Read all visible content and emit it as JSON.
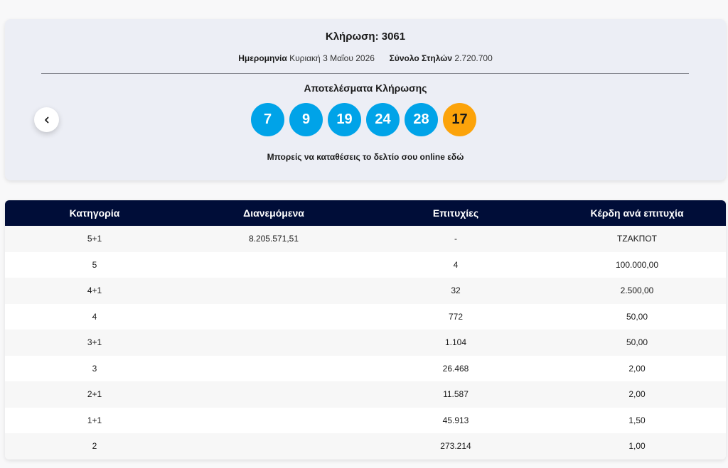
{
  "draw": {
    "title": "Κλήρωση: 3061",
    "date_label": "Ημερομηνία",
    "date_value": "Κυριακή 3 Μαΐου 2026",
    "columns_label": "Σύνολο Στηλών",
    "columns_value": "2.720.700",
    "results_title": "Αποτελέσματα Κλήρωσης",
    "numbers": [
      "7",
      "9",
      "19",
      "24",
      "28"
    ],
    "bonus": "17",
    "online_text": "Μπορείς να καταθέσεις το δελτίο σου online εδώ",
    "prev_icon": "chevron-left-icon"
  },
  "colors": {
    "ball": "#00a3e8",
    "bonus_ball": "#fca30a",
    "table_header": "#000d38"
  },
  "table": {
    "headers": [
      "Κατηγορία",
      "Διανεμόμενα",
      "Επιτυχίες",
      "Κέρδη ανά επιτυχία"
    ],
    "rows": [
      [
        "5+1",
        "8.205.571,51",
        "-",
        "ΤΖΑΚΠΟΤ"
      ],
      [
        "5",
        "",
        "4",
        "100.000,00"
      ],
      [
        "4+1",
        "",
        "32",
        "2.500,00"
      ],
      [
        "4",
        "",
        "772",
        "50,00"
      ],
      [
        "3+1",
        "",
        "1.104",
        "50,00"
      ],
      [
        "3",
        "",
        "26.468",
        "2,00"
      ],
      [
        "2+1",
        "",
        "11.587",
        "2,00"
      ],
      [
        "1+1",
        "",
        "45.913",
        "1,50"
      ],
      [
        "2",
        "",
        "273.214",
        "1,00"
      ]
    ]
  }
}
